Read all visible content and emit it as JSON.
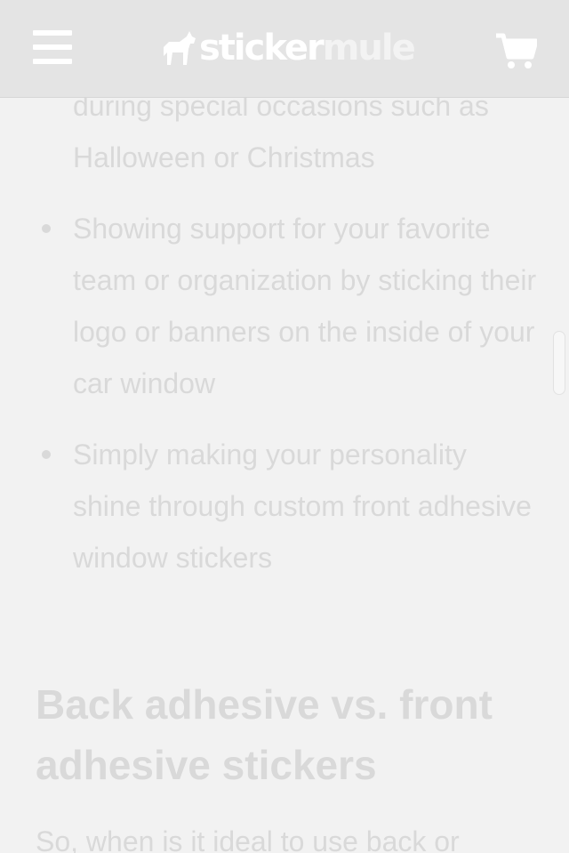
{
  "header": {
    "logo_primary": "sticker",
    "logo_secondary": "mule",
    "menu_icon": "hamburger-menu-icon",
    "cart_icon": "shopping-cart-icon"
  },
  "bullets": [
    {
      "text": "during special occasions such as Halloween or Christmas"
    },
    {
      "text": "Showing support for your favorite team or organization by sticking their logo or banners on the inside of your car window"
    },
    {
      "text": "Simply making your personality shine through custom front adhesive window stickers"
    }
  ],
  "section": {
    "heading": "Back adhesive vs. front adhesive stickers",
    "body": "So, when is it ideal to use back or"
  },
  "colors": {
    "header_bg": "#e4e4e4",
    "page_bg": "#f2f2f2",
    "text": "#d9d9d9"
  }
}
